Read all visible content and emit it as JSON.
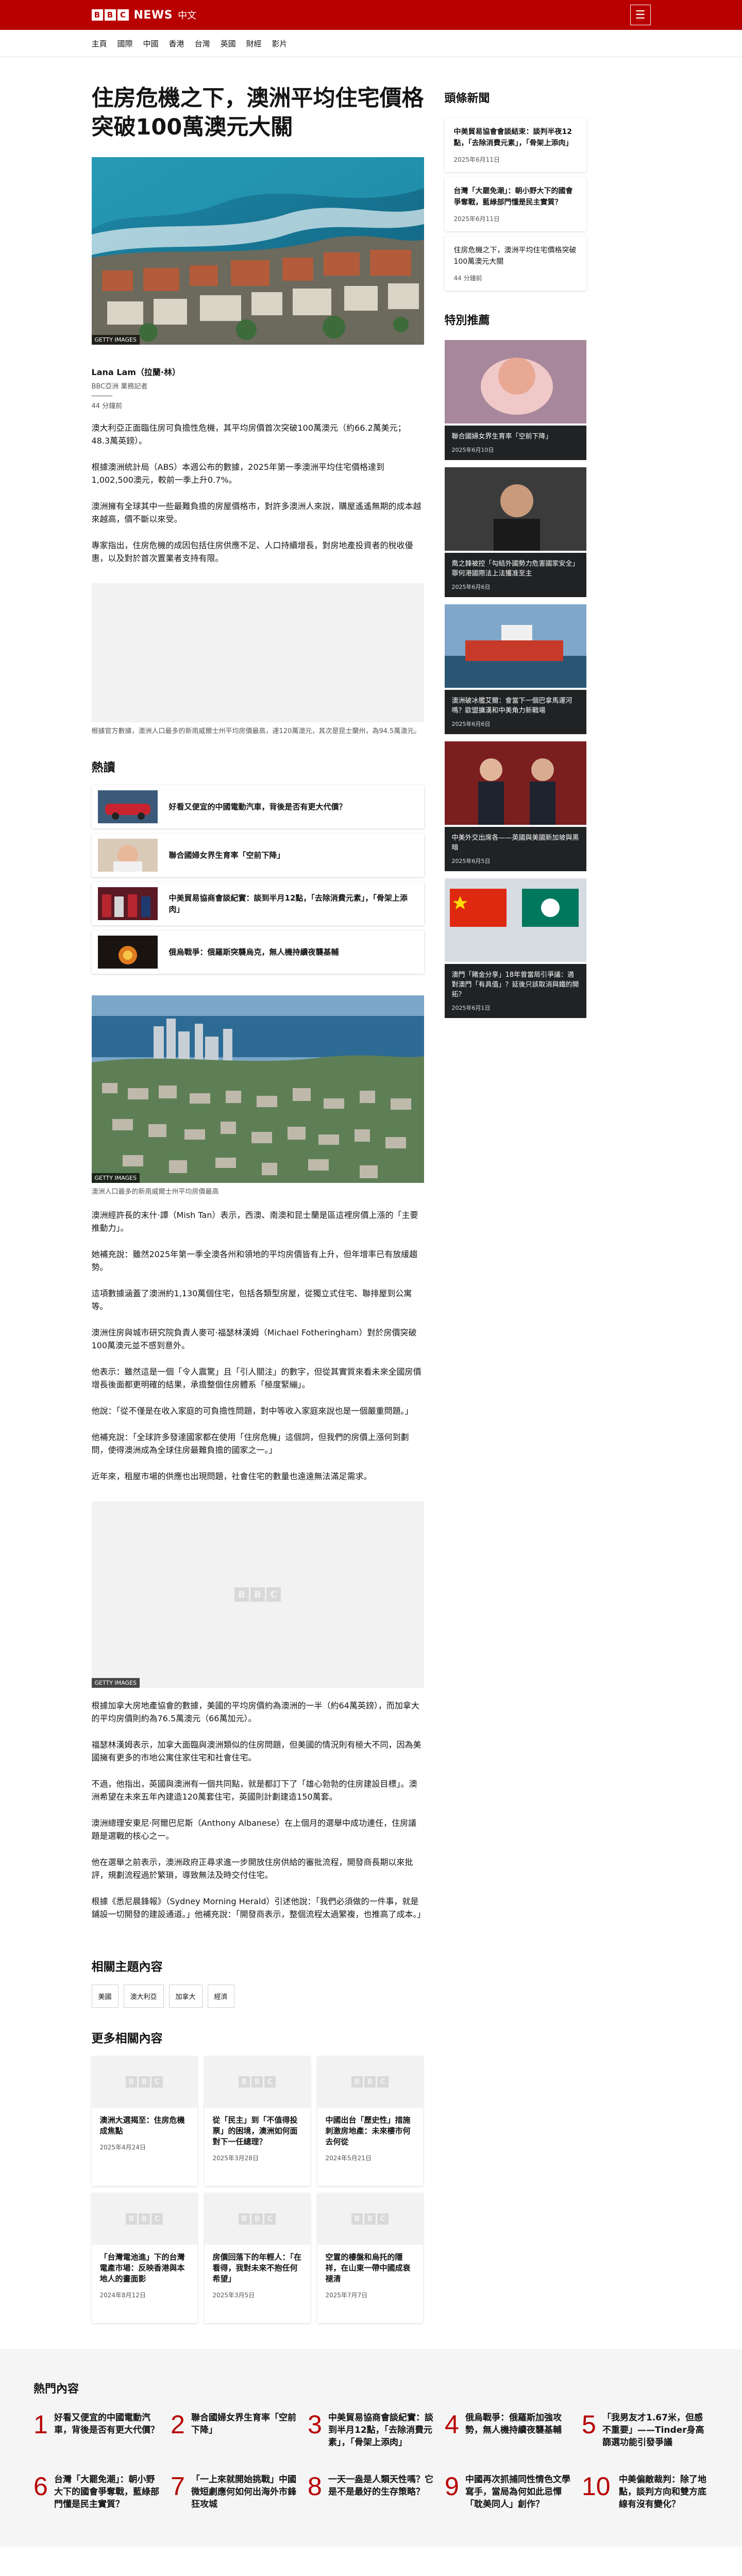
{
  "header": {
    "logo_letters": [
      "B",
      "B",
      "C"
    ],
    "brand_news": "NEWS",
    "brand_lang": "中文",
    "menu_icon": "hamburger-menu-icon"
  },
  "nav": [
    "主頁",
    "國際",
    "中國",
    "香港",
    "台灣",
    "英國",
    "財經",
    "影片"
  ],
  "article": {
    "title": "住房危機之下，澳洲平均住宅價格突破100萬澳元大關",
    "hero_credit": "GETTY IMAGES",
    "author": "Lana Lam（拉蘭·林）",
    "author_role": "BBC亞洲 業務記者",
    "date": "44 分鐘前",
    "paragraphs_1": [
      "澳大利亞正面臨住房可負擔性危機，其平均房價首次突破100萬澳元（約66.2萬美元；48.3萬英鎊）。",
      "根據澳洲統計局（ABS）本週公布的數據，2025年第一季澳洲平均住宅價格達到1,002,500澳元，較前一季上升0.7%。",
      "澳洲擁有全球其中一些最難負擔的房屋價格市，對許多澳洲人來說，購屋遙遙無期的成本越來越高，價不斷以來受。",
      "專家指出，住房危機的成因包括住房供應不足、人口持續增長，對房地產投資者的稅收優惠，以及對於首次置業者支持有限。"
    ],
    "image2_caption": "根據官方數據，澳洲人口最多的新南威爾士州平均房價最高，達120萬澳元，其次是昆士蘭州，為94.5萬澳元。",
    "paragraphs_2": [
      "澳洲經許長的末什·譚（Mish Tan）表示，西澳、南澳和昆士蘭是區這裡房價上漲的「主要推動力」。",
      "她補充說：雖然2025年第一季全澳各州和領地的平均房價皆有上升，但年增率已有放緩趨勢。",
      "這項數據涵蓋了澳洲約1,130萬個住宅，包括各類型房屋，從獨立式住宅、聯排屋到公寓等。",
      "澳洲住房與城市研究院負責人麥可·福瑟林漢姆（Michael Fotheringham）對於房價突破100萬澳元並不感到意外。",
      "他表示：雖然這是一個「令人震驚」且「引人關注」的數字，但從其實質來看未來全國房價增長後面都更明確的結果，承擔整個住房體系「極度緊繃」。",
      "他說：「從不僅是在收入家庭的可負擔性問題，對中等收入家庭來說也是一個嚴重問題。」",
      "他補充說：「全球許多發達國家都在使用「住房危機」這個詞，但我們的房價上漲何到劃問，使得澳洲成為全球住房最難負擔的國家之一。」",
      "近年來，租屋市場的供應也出現問題，社會住宅的數量也遠遠無法滿足需求。"
    ],
    "image3_credit": "GETTY IMAGES",
    "image3_caption": "",
    "paragraphs_3": [
      "根據加拿大房地產協會的數據，美國的平均房價約為澳洲的一半（約64萬英鎊），而加拿大的平均房價則約為76.5萬澳元（66萬加元）。",
      "福瑟林漢姆表示，加拿大面臨與澳洲類似的住房問題，但美國的情況則有極大不同，因為美國擁有更多的市地公寓住家住宅和社會住宅。",
      "不過，他指出，英國與澳洲有一個共同點，就是都訂下了「雄心勃勃的住房建設目標」。澳洲希望在未來五年內建造120萬套住宅，英國則計劃建造150萬套。",
      "澳洲總理安東尼·阿爾巴尼斯（Anthony Albanese）在上個月的選舉中成功連任，住房議題是選戰的核心之一。",
      "他在選舉之前表示，澳洲政府正尋求進一步開放住房供給的審批流程，開發商長期以來批評，規劃流程過於繁瑣，導致無法及時交付住宅。",
      "根據《悉尼晨鋒報》（Sydney Morning Herald）引述他說：「我們必須做的一件事，就是鋪設一切開發的建設通道。」他補充說：「開發商表示，整個流程太過繁複，也推高了成本。」"
    ]
  },
  "hot": {
    "heading": "熱讀",
    "items": [
      "好看又便宜的中國電動汽車，背後是否有更大代價？",
      "聯合國婦女界生育率「空前下降」",
      "中美貿易協商會談紀實：談到半月12點，「去除消費元素」，「骨架上添肉」",
      "俄烏戰爭：俄羅斯突襲烏克，無人機持續夜襲基輔"
    ]
  },
  "related_topics": {
    "heading": "相關主題內容",
    "tags": [
      "美國",
      "澳大利亞",
      "加拿大",
      "經濟"
    ]
  },
  "more": {
    "heading": "更多相關內容",
    "items": [
      {
        "title": "澳洲大選揭至：住房危機成焦點",
        "date": "2025年4月24日"
      },
      {
        "title": "從「民主」到「不值得投票」的困境，澳洲如何面對下一任總理？",
        "date": "2025年3月28日"
      },
      {
        "title": "中國出台「歷史性」措施刺激房地產：未來樓市何去何從",
        "date": "2024年5月21日"
      },
      {
        "title": "「台灣電池進」下的台灣電產市場：反映香港與本地人的畫面影",
        "date": "2024年8月12日"
      },
      {
        "title": "房價回落下的年輕人：「在看得，我對未來不抱任何希望」",
        "date": "2025年3月5日"
      },
      {
        "title": "空置的樓盤和烏托的隱祥，在山東一帶中國成衰褪清",
        "date": "2025年7月7日"
      }
    ]
  },
  "sidebar": {
    "top_heading": "頭條新聞",
    "top": [
      {
        "title": "中美貿易協會會談結束：談判半夜12點，「去除消費元素」，「骨架上添肉」",
        "date": "2025年6月11日",
        "bold": true
      },
      {
        "title": "台灣「大罷免潮」：朝小野大下的國會爭奪戰，藍綠部門懂是民主實質？",
        "date": "2025年6月11日",
        "bold": true
      },
      {
        "title": "住房危機之下，澳洲平均住宅價格突破100萬澳元大關",
        "date": "44 分鐘前",
        "bold": false
      }
    ],
    "featured_heading": "特別推薦",
    "featured": [
      {
        "title": "聯合國婦女界生育率「空前下降」",
        "date": "2025年6月10日"
      },
      {
        "title": "喬之鋒被控「勾結外國勢力危害國家安全」罪何港國際法上法獲准至主",
        "date": "2025年6月6日"
      },
      {
        "title": "澳洲破冰艦艾爾：會當下一個巴拿馬運河嗎？歐盟擴漢和中美角力新戰場",
        "date": "2025年6月6日"
      },
      {
        "title": "中美外交出席各——英國與美國新加坡與黑暗",
        "date": "2025年6月5日"
      },
      {
        "title": "澳門「賭金分享」18年曾當局引爭議：適對澳門「有具值」？延後只該取消與鐵的開拓？",
        "date": "2025年6月1日"
      }
    ]
  },
  "popular": {
    "heading": "熱門內容",
    "items": [
      {
        "n": "1",
        "title": "好看又便宜的中國電動汽車，背後是否有更大代價？"
      },
      {
        "n": "2",
        "title": "聯合國婦女界生育率「空前下降」"
      },
      {
        "n": "3",
        "title": "中美貿易協商會談紀實：談到半月12點，「去除消費元素」，「骨架上添肉」"
      },
      {
        "n": "4",
        "title": "俄烏戰爭：俄羅斯加強攻勢，無人機持續夜襲基輔"
      },
      {
        "n": "5",
        "title": "「我男友才1.67米，但感不重要」——Tinder身高篩選功能引發爭議"
      },
      {
        "n": "6",
        "title": "台灣「大罷免潮」：朝小野大下的國會爭奪戰，藍綠部門懂是民主實質？"
      },
      {
        "n": "7",
        "title": "「一上來就開始挑戰」中國微短劇應何如何出海外市鋒狂攻城"
      },
      {
        "n": "8",
        "title": "一天一盎是人類天性嗎？它是不是最好的生存策略？"
      },
      {
        "n": "9",
        "title": "中國再次抓捕同性情色文學寫手，當局為何如此忌憚「耽美同人」創作？"
      },
      {
        "n": "10",
        "title": "中美偏敵裁判：除了地點，談判方向和雙方底線有沒有變化？"
      }
    ]
  },
  "colors": {
    "brand_red": "#b80000",
    "accent_number": "#b80000"
  }
}
